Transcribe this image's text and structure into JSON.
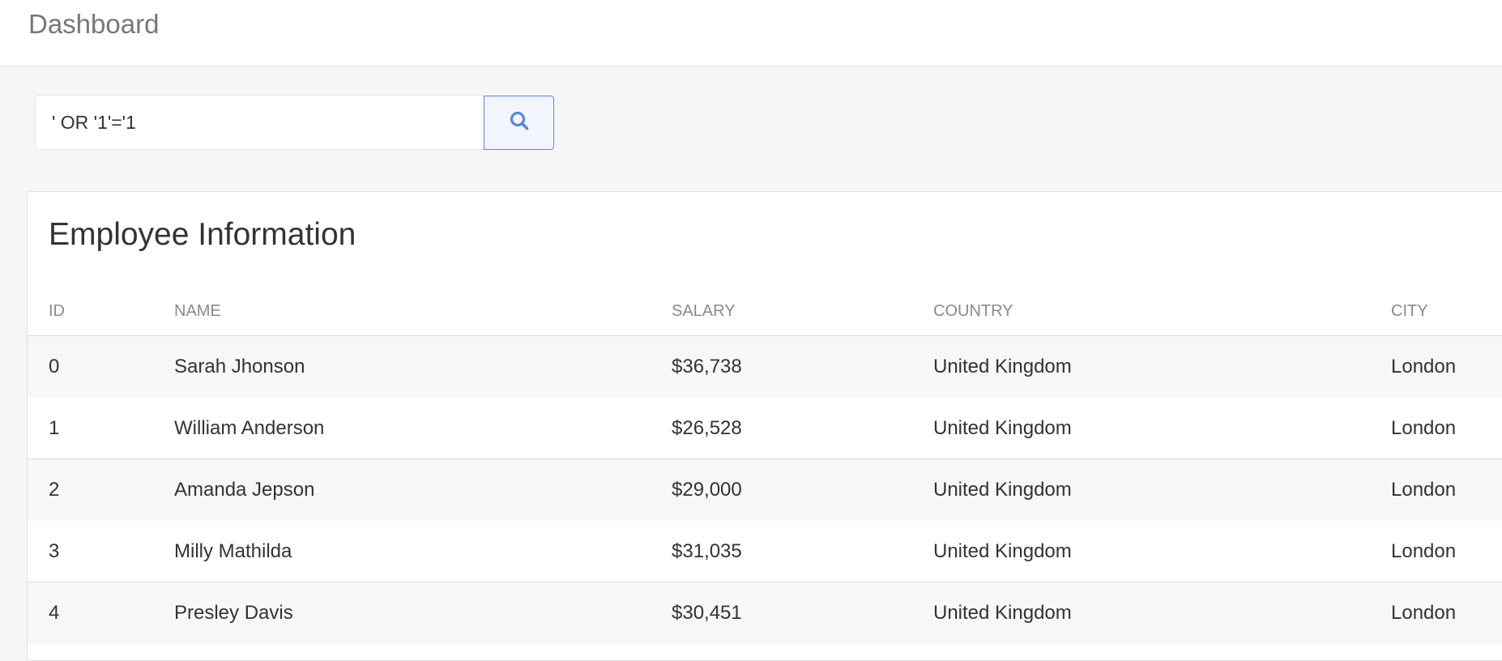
{
  "header": {
    "title": "Dashboard"
  },
  "search": {
    "value": "' OR '1'='1",
    "button_icon": "search-icon",
    "accent_color": "#5b86dc"
  },
  "card": {
    "title": "Employee Information"
  },
  "table": {
    "columns": [
      "ID",
      "NAME",
      "SALARY",
      "COUNTRY",
      "CITY"
    ],
    "rows": [
      {
        "id": "0",
        "name": "Sarah Jhonson",
        "salary": "$36,738",
        "country": "United Kingdom",
        "city": "London"
      },
      {
        "id": "1",
        "name": "William Anderson",
        "salary": "$26,528",
        "country": "United Kingdom",
        "city": "London"
      },
      {
        "id": "2",
        "name": "Amanda Jepson",
        "salary": "$29,000",
        "country": "United Kingdom",
        "city": "London"
      },
      {
        "id": "3",
        "name": "Milly Mathilda",
        "salary": "$31,035",
        "country": "United Kingdom",
        "city": "London"
      },
      {
        "id": "4",
        "name": "Presley Davis",
        "salary": "$30,451",
        "country": "United Kingdom",
        "city": "London"
      }
    ]
  }
}
